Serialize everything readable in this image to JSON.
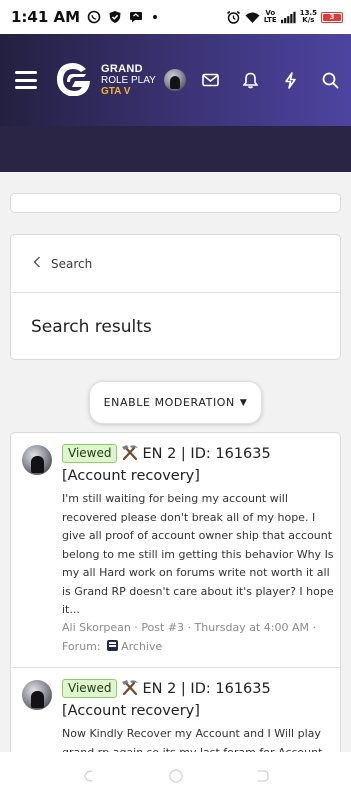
{
  "status_bar": {
    "time": "1:41 AM",
    "network_top": "Vo",
    "network_bottom": "LTE",
    "speed_value": "13.5",
    "speed_unit": "K/s",
    "battery": "3",
    "icons": [
      "whatsapp-icon",
      "shield-check-icon",
      "chat-bubble-icon",
      "dot-icon",
      "alarm-icon",
      "wifi-icon",
      "signal-icon",
      "battery-icon"
    ]
  },
  "header": {
    "brand_line1": "GRAND",
    "brand_line2": "ROLE PLAY",
    "brand_line3": "GTA V",
    "icons": [
      "menu-icon",
      "grand-logo-icon",
      "avatar",
      "mail-icon",
      "bell-icon",
      "lightning-icon",
      "search-icon"
    ],
    "colors": {
      "gradient_start": "#232040",
      "gradient_end": "#4d44a0",
      "brand_accent": "#f2b632"
    }
  },
  "breadcrumb": {
    "label": "Search"
  },
  "page_title": "Search results",
  "moderation_button": {
    "label": "ENABLE MODERATION"
  },
  "results": [
    {
      "badge": "Viewed",
      "title_line1": "EN 2 | ID: 161635",
      "title_line2": "[Account recovery]",
      "snippet": "I'm still waiting for being my account will recovered please don't break all of my hope. I give all proof of account owner ship that account belong to me still im getting this behavior Why Is my all Hard work on forums write not worth it all is Grand RP doesn't care about it's player? I hope it...",
      "meta_author": "Ali Skorpean",
      "meta_post": "Post #3",
      "meta_time": "Thursday at 4:00 AM",
      "meta_forum_label": "Forum:",
      "meta_forum": "Archive"
    },
    {
      "badge": "Viewed",
      "title_line1": "EN 2 | ID: 161635",
      "title_line2": "[Account recovery]",
      "snippet": "Now Kindly Recover my Account and I Will play grand rp again so its my last foram for Account"
    }
  ],
  "colors": {
    "viewed_bg": "#dff5cf",
    "viewed_border": "#8ccf66",
    "page_bg": "#f2f2f2"
  }
}
